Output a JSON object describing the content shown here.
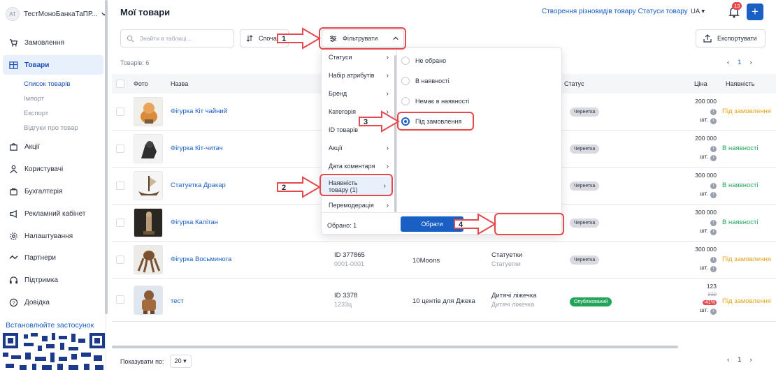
{
  "shop": {
    "avatar": "АТ",
    "name": "ТестМоноБанкаТаПР..."
  },
  "sidebar": {
    "items": [
      {
        "label": "Замовлення",
        "icon": "cart-icon"
      },
      {
        "label": "Товари",
        "icon": "products-icon"
      },
      {
        "label": "Акції",
        "icon": "promo-icon"
      },
      {
        "label": "Користувачі",
        "icon": "users-icon"
      },
      {
        "label": "Бухгалтерія",
        "icon": "accounting-icon"
      },
      {
        "label": "Рекламний кабінет",
        "icon": "megaphone-icon"
      },
      {
        "label": "Налаштування",
        "icon": "gear-icon"
      },
      {
        "label": "Партнери",
        "icon": "handshake-icon"
      },
      {
        "label": "Підтримка",
        "icon": "support-icon"
      },
      {
        "label": "Довідка",
        "icon": "help-icon"
      }
    ],
    "subitems": [
      "Список товарів",
      "Імпорт",
      "Експорт",
      "Відгуки про товар"
    ],
    "install": "Встановлюйте застосунок"
  },
  "header": {
    "title": "Мої товари",
    "link_variants": "Створення різновидів товару",
    "link_statuses": "Статуси товару",
    "lang": "UA",
    "notifications": "13",
    "plus": "+"
  },
  "toolbar": {
    "search_placeholder": "Знайти в таблиці...",
    "sort_label": "Спочат",
    "filter_label": "Фільтрувати",
    "export_label": "Експортувати"
  },
  "table": {
    "count": "Товарів: 6",
    "page": "1",
    "columns": {
      "photo": "Фото",
      "name": "Назва",
      "status": "Статус",
      "price": "Ціна",
      "availability": "Наявність"
    },
    "rows": [
      {
        "name": "Фігурка Кіт чайний",
        "id": "",
        "sku": "",
        "brand": "",
        "cat": "",
        "cat2": "",
        "status": "Чернетка",
        "price": "200 000",
        "price_old": "",
        "discount": "",
        "unit": "шт.",
        "avail": "Під замовлення"
      },
      {
        "name": "Фігурка Кіт-читач",
        "id": "",
        "sku": "",
        "brand": "",
        "cat": "",
        "cat2": "",
        "status": "Чернетка",
        "price": "200 000",
        "price_old": "",
        "discount": "",
        "unit": "шт.",
        "avail": "В наявності"
      },
      {
        "name": "Статуетка Дракар",
        "id": "",
        "sku": "",
        "brand": "",
        "cat": "",
        "cat2": "",
        "status": "Чернетка",
        "price": "300 000",
        "price_old": "",
        "discount": "",
        "unit": "шт.",
        "avail": "В наявності"
      },
      {
        "name": "Фігурка Капітан",
        "id": "",
        "sku": "",
        "brand": "",
        "cat": "",
        "cat2": "",
        "status": "Чернетка",
        "price": "300 000",
        "price_old": "",
        "discount": "",
        "unit": "шт.",
        "avail": "В наявності"
      },
      {
        "name": "Фігурка Восьминога",
        "id": "ID 377865",
        "sku": "0001-0001",
        "brand": "10Moons",
        "cat": "Статуетки",
        "cat2": "Статуетки",
        "status": "Чернетка",
        "price": "300 000",
        "price_old": "",
        "discount": "",
        "unit": "шт.",
        "avail": "Під замовлення"
      },
      {
        "name": "тест",
        "id": "ID 3378",
        "sku": "1233ц",
        "brand": "10 центів для Джека",
        "cat": "Дитячі ліжечка",
        "cat2": "Дитячі ліжечка",
        "status": "Опублікований",
        "price": "123",
        "price_old": "232",
        "discount": "-41%",
        "unit": "шт.",
        "avail": "Під замовлення"
      }
    ]
  },
  "filter_menu": {
    "categories": [
      "Статуси",
      "Набір атрибутів",
      "Бренд",
      "Категорія",
      "ID товарів",
      "Акції",
      "Дата коментаря",
      "Наявність товару (1)",
      "Перемодерація"
    ],
    "options": [
      "Не обрано",
      "В наявності",
      "Немає в наявності",
      "Під замовлення"
    ],
    "selected_count": "Обрано: 1",
    "apply": "Обрати"
  },
  "footer": {
    "per_page_label": "Показувати по:",
    "per_page": "20",
    "page": "1"
  },
  "callouts": [
    "1",
    "2",
    "3",
    "4"
  ],
  "colors": {
    "accent": "#1a5fc4",
    "annotation": "#e5484d",
    "order": "#e8a317",
    "ok": "#22a55a"
  }
}
